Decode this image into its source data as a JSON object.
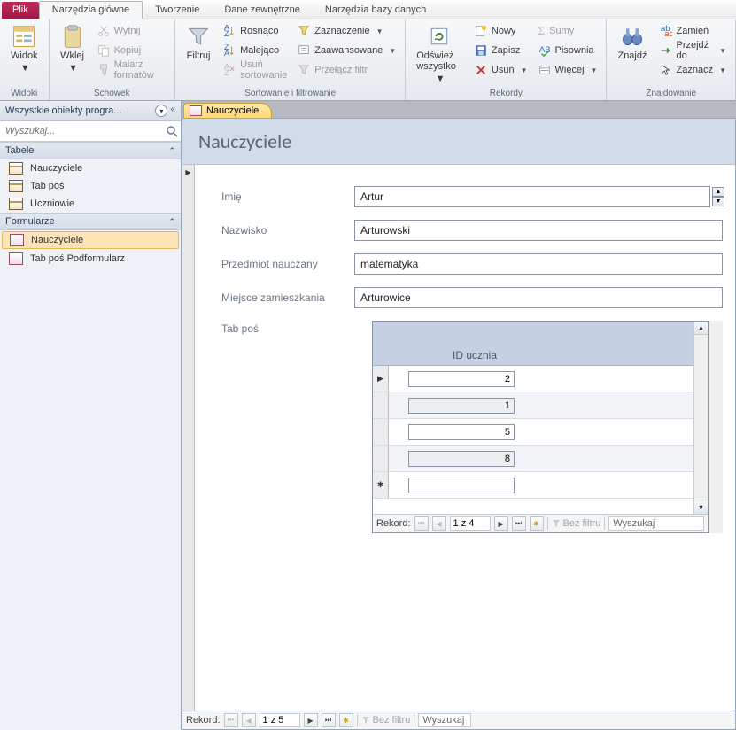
{
  "tabs": {
    "file": "Plik",
    "home": "Narzędzia główne",
    "create": "Tworzenie",
    "external": "Dane zewnętrzne",
    "dbtools": "Narzędzia bazy danych"
  },
  "ribbon": {
    "views": {
      "label": "Widok",
      "group": "Widoki"
    },
    "clipboard": {
      "paste": "Wklej",
      "cut": "Wytnij",
      "copy": "Kopiuj",
      "painter": "Malarz formatów",
      "group": "Schowek"
    },
    "sortfilter": {
      "filter": "Filtruj",
      "asc": "Rosnąco",
      "desc": "Malejąco",
      "clear": "Usuń sortowanie",
      "selection": "Zaznaczenie",
      "advanced": "Zaawansowane",
      "toggle": "Przełącz filtr",
      "group": "Sortowanie i filtrowanie"
    },
    "records": {
      "refresh": "Odśwież wszystko",
      "new": "Nowy",
      "save": "Zapisz",
      "delete": "Usuń",
      "totals": "Sumy",
      "spelling": "Pisownia",
      "more": "Więcej",
      "group": "Rekordy"
    },
    "find": {
      "find": "Znajdź",
      "replace": "Zamień",
      "goto": "Przejdź do",
      "select": "Zaznacz",
      "group": "Znajdowanie"
    }
  },
  "nav": {
    "title": "Wszystkie obiekty progra...",
    "search_placeholder": "Wyszukaj...",
    "sections": {
      "tables": {
        "title": "Tabele",
        "items": [
          "Nauczyciele",
          "Tab poś",
          "Uczniowie"
        ]
      },
      "forms": {
        "title": "Formularze",
        "items": [
          "Nauczyciele",
          "Tab poś Podformularz"
        ]
      }
    }
  },
  "doc": {
    "tab": "Nauczyciele",
    "title": "Nauczyciele",
    "fields": {
      "f1": {
        "label": "Imię",
        "value": "Artur"
      },
      "f2": {
        "label": "Nazwisko",
        "value": "Arturowski"
      },
      "f3": {
        "label": "Przedmiot nauczany",
        "value": "matematyka"
      },
      "f4": {
        "label": "Miejsce zamieszkania",
        "value": "Arturowice"
      }
    },
    "subform": {
      "label": "Tab poś",
      "column": "ID ucznia",
      "rows": [
        "2",
        "1",
        "5",
        "8"
      ],
      "nav": {
        "label": "Rekord:",
        "pos": "1 z 4",
        "filter": "Bez filtru",
        "search": "Wyszukaj"
      }
    },
    "nav": {
      "label": "Rekord:",
      "pos": "1 z 5",
      "filter": "Bez filtru",
      "search": "Wyszukaj"
    }
  }
}
